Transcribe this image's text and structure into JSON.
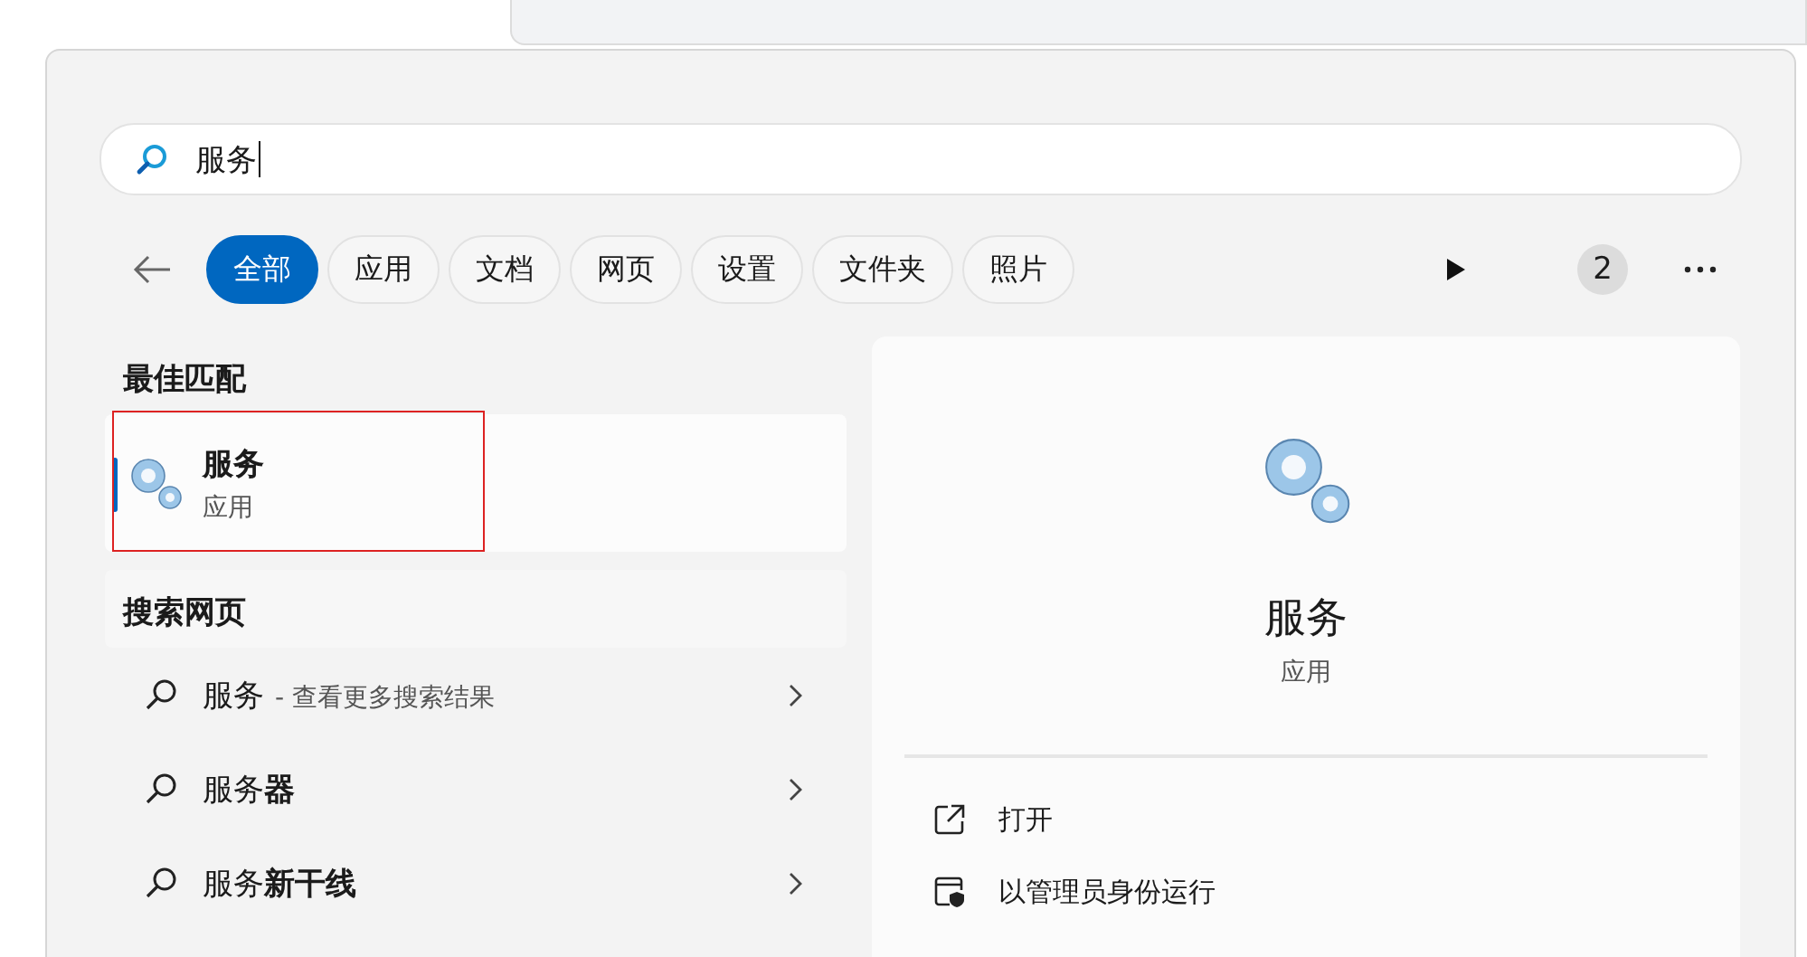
{
  "search": {
    "value": "服务"
  },
  "filters": [
    {
      "label": "全部",
      "selected": true
    },
    {
      "label": "应用",
      "selected": false
    },
    {
      "label": "文档",
      "selected": false
    },
    {
      "label": "网页",
      "selected": false
    },
    {
      "label": "设置",
      "selected": false
    },
    {
      "label": "文件夹",
      "selected": false
    },
    {
      "label": "照片",
      "selected": false
    }
  ],
  "badge": "2",
  "best_match": {
    "heading": "最佳匹配",
    "title": "服务",
    "subtitle": "应用",
    "selected": true,
    "annotated": true
  },
  "web": {
    "heading": "搜索网页",
    "items": [
      {
        "text": "服务",
        "suffix": "- 查看更多搜索结果"
      },
      {
        "text": "服务**器**"
      },
      {
        "text": "服务**新干线**"
      }
    ]
  },
  "detail": {
    "title": "服务",
    "subtitle": "应用",
    "actions": [
      {
        "kind": "open",
        "label": "打开"
      },
      {
        "kind": "admin",
        "label": "以管理员身份运行"
      }
    ]
  }
}
